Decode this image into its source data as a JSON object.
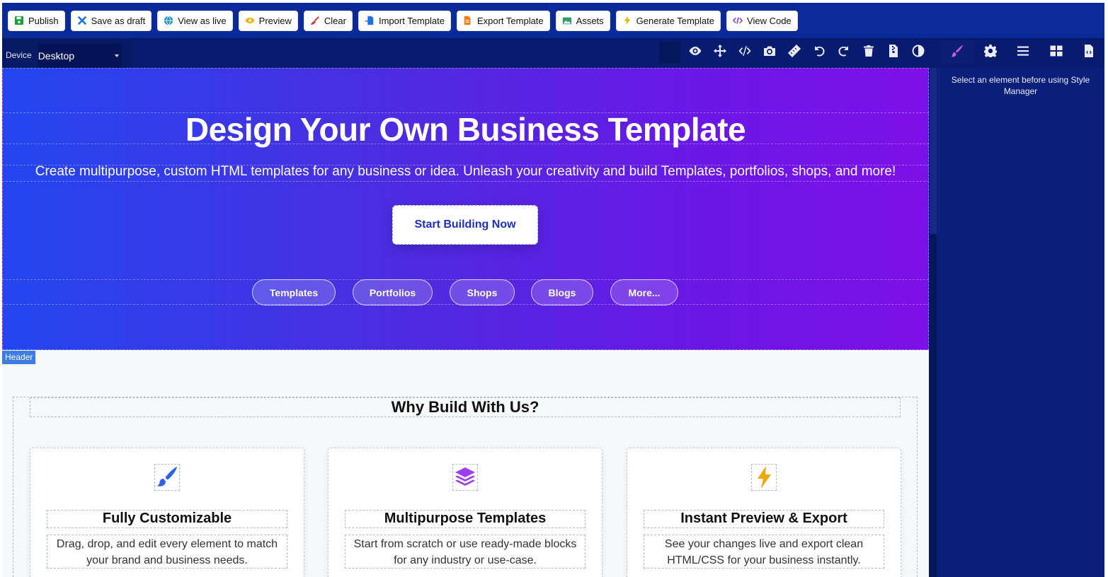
{
  "toolbar": {
    "buttons": [
      {
        "label": "Publish",
        "icon": "save-icon",
        "color": "#1f9d3a"
      },
      {
        "label": "Save as draft",
        "icon": "tools-icon",
        "color": "#1e6fe0"
      },
      {
        "label": "View as live",
        "icon": "globe-icon",
        "color": "#1e8fd0"
      },
      {
        "label": "Preview",
        "icon": "eye-icon",
        "color": "#f0b400"
      },
      {
        "label": "Clear",
        "icon": "broom-icon",
        "color": "#d62828"
      },
      {
        "label": "Import Template",
        "icon": "file-import-icon",
        "color": "#1e6fe0"
      },
      {
        "label": "Export Template",
        "icon": "file-export-icon",
        "color": "#f07a16"
      },
      {
        "label": "Assets",
        "icon": "image-icon",
        "color": "#2a9d6a"
      },
      {
        "label": "Generate Template",
        "icon": "bolt-icon",
        "color": "#f0b400"
      },
      {
        "label": "View Code",
        "icon": "code-icon",
        "color": "#7b3fe4"
      }
    ]
  },
  "device": {
    "label": "Device",
    "value": "Desktop"
  },
  "panel_tools": [
    "eye-icon",
    "move-icon",
    "code-icon",
    "camera-icon",
    "ruler-icon",
    "undo-icon",
    "redo-icon",
    "trash-icon",
    "file-zip-icon",
    "contrast-icon"
  ],
  "right_tools": [
    "paintbrush-icon",
    "gear-icon",
    "layers-icon",
    "blocks-icon",
    "file-code-icon"
  ],
  "right_panel": {
    "message": "Select an element before using Style Manager"
  },
  "hero": {
    "title": "Design Your Own Business Template",
    "subtitle": "Create multipurpose, custom HTML templates for any business or idea. Unleash your creativity and build Templates, portfolios, shops, and more!",
    "cta": "Start Building Now",
    "pills": [
      "Templates",
      "Portfolios",
      "Shops",
      "Blogs",
      "More..."
    ]
  },
  "badge": "Header",
  "why": {
    "title": "Why Build With Us?",
    "cards": [
      {
        "title": "Fully Customizable",
        "desc": "Drag, drop, and edit every element to match your brand and business needs.",
        "icon": "paintbrush-icon",
        "color": "#2d63e8"
      },
      {
        "title": "Multipurpose Templates",
        "desc": "Start from scratch or use ready-made blocks for any industry or use-case.",
        "icon": "layers-icon",
        "color": "#9b3ff0"
      },
      {
        "title": "Instant Preview & Export",
        "desc": "See your changes live and export clean HTML/CSS for your business instantly.",
        "icon": "bolt-icon",
        "color": "#f0a800"
      }
    ]
  },
  "colors": {
    "toolbar": "#0a2a9a",
    "panel": "#071c6e",
    "accent": "#1b2fc7",
    "hero_start": "#2346f0",
    "hero_end": "#7c10e8"
  }
}
